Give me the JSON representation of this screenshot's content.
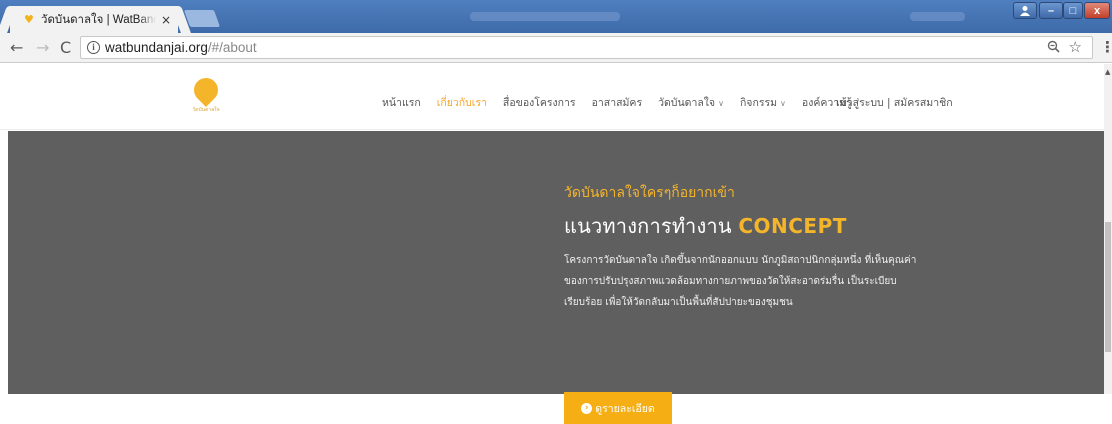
{
  "browser": {
    "tab_title": "วัดบันดาลใจ | WatBandanjai",
    "tab_close": "×",
    "url_host": "watbundanjai.org",
    "url_path": "/#/about",
    "icons": [
      "back-arrow-icon",
      "forward-arrow-icon",
      "reload-icon",
      "info-icon",
      "zoom-icon",
      "star-icon",
      "menu-icon"
    ]
  },
  "window": {
    "minimize": "–",
    "maximize": "□",
    "close": "x"
  },
  "site": {
    "logo_text": "วัดบันดาลใจ",
    "nav": [
      {
        "label": "หน้าแรก"
      },
      {
        "label": "เกี่ยวกับเรา"
      },
      {
        "label": "สื่อของโครงการ"
      },
      {
        "label": "อาสาสมัคร"
      },
      {
        "label": "วัดบันดาลใจ"
      },
      {
        "label": "กิจกรรม"
      },
      {
        "label": "องค์ความรู้"
      }
    ],
    "account": "เข้าสู่ระบบ | สมัครสมาชิก",
    "accent_color": "#f5b52b"
  },
  "hero": {
    "kicker": "วัดบันดาลใจใครๆก็อยากเข้า",
    "title_th": "แนวทางการทำงาน",
    "title_en": "CONCEPT",
    "desc": "โครงการวัดบันดาลใจ เกิดขึ้นจากนักออกแบบ นักภูมิสถาปนิกกลุ่มหนึ่ง ที่เห็นคุณค่าของการปรับปรุงสภาพแวดล้อมทางกายภาพของวัดให้สะอาดร่มรื่น เป็นระเบียบเรียบร้อย เพื่อให้วัดกลับมาเป็นพื้นที่สัปปายะของชุมชน",
    "button_label": "ดูรายละเอียด"
  }
}
